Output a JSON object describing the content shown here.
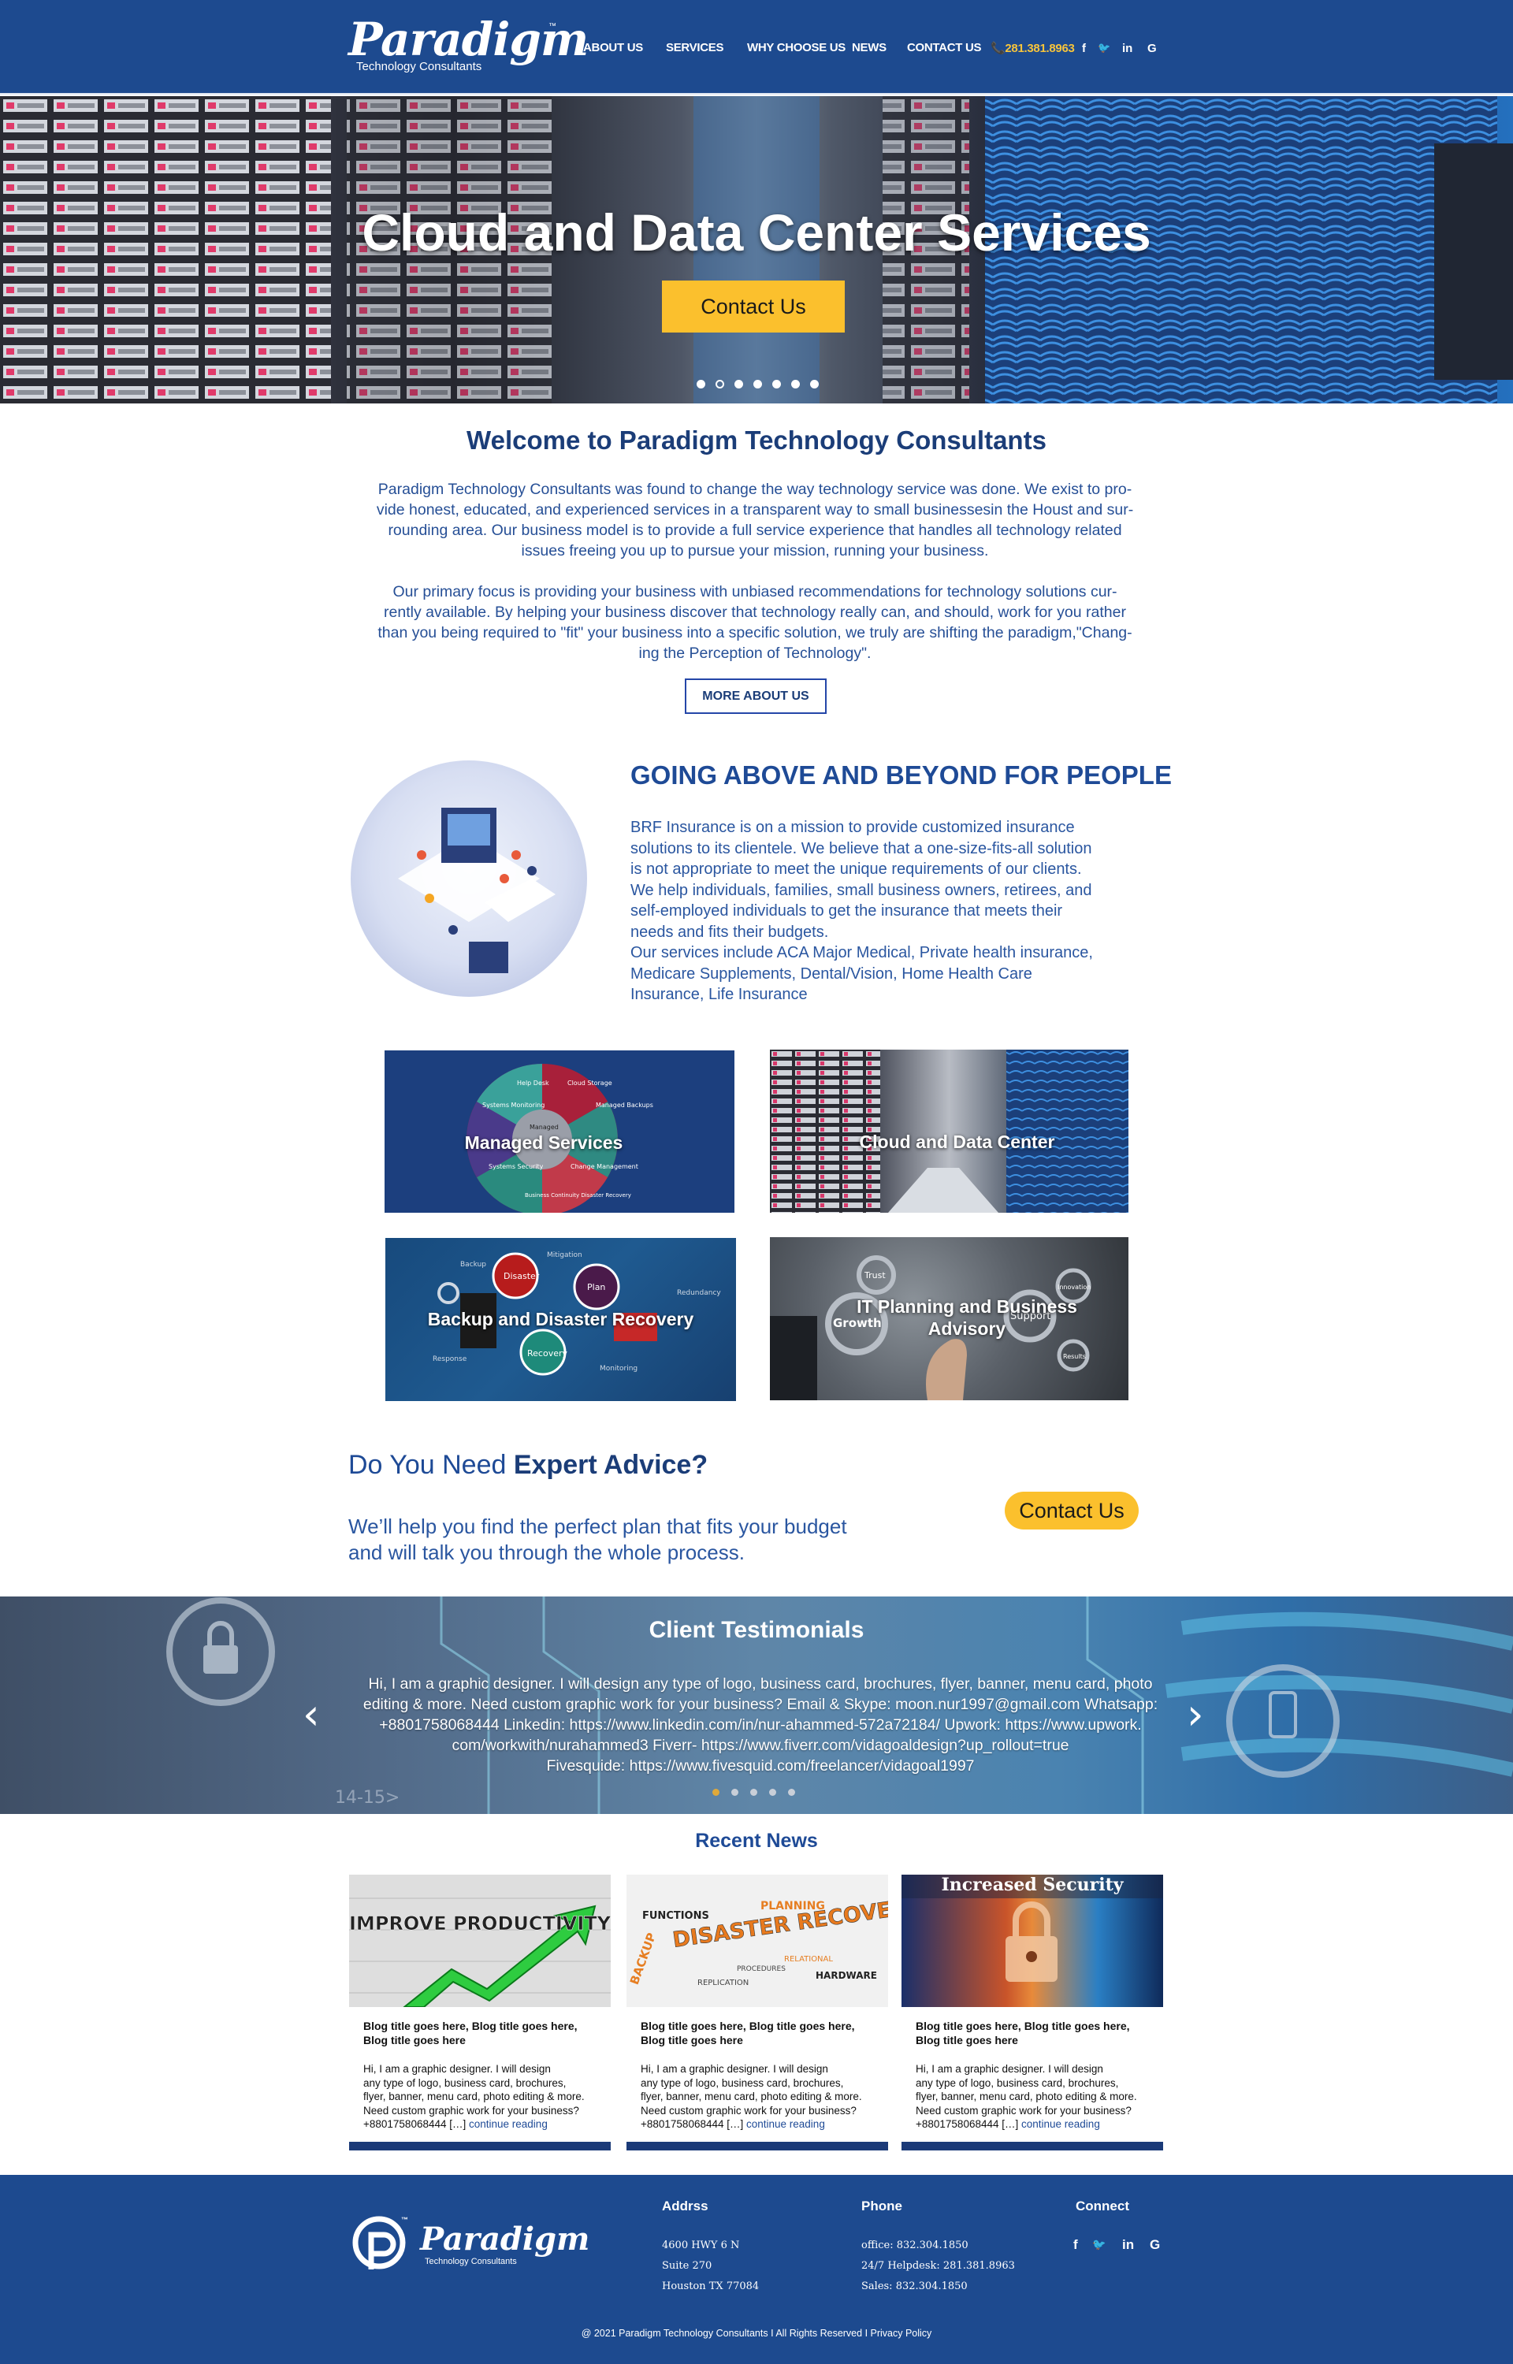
{
  "header": {
    "logo_text": "Paradigm",
    "logo_tm": "™",
    "logo_sub": "Technology Consultants",
    "nav": [
      "ABOUT US",
      "SERVICES",
      "WHY CHOOSE US",
      "NEWS",
      "CONTACT US"
    ],
    "phone": "📞281.381.8963",
    "social_icons": [
      "facebook-icon",
      "twitter-icon",
      "linkedin-icon",
      "google-icon"
    ],
    "social_glyphs": [
      "f",
      "🐦",
      "in",
      "G"
    ]
  },
  "hero": {
    "title": "Cloud and Data Center Services",
    "button": "Contact Us",
    "slides": 7,
    "active_slide": 2
  },
  "welcome": {
    "title": "Welcome to Paradigm Technology Consultants",
    "p1_lines": [
      "Paradigm Technology Consultants was found to change the way technology service was done. We exist to pro-",
      "vide honest, educated, and experienced services in a transparent way to small businessesin the Houst and sur-",
      "rounding area. Our business model is to provide a full service experience that handles all technology related",
      "issues freeing you up to pursue your mission, running your business."
    ],
    "p2_lines": [
      "Our primary focus is providing your business with unbiased recommendations for technology solutions cur-",
      "rently available. By helping your business discover that technology really can, and should, work for you rather",
      "than you being required to \"fit\" your business into a specific solution, we truly are shifting the paradigm,\"Chang-",
      "ing the Perception of Technology\"."
    ],
    "button": "MORE ABOUT US"
  },
  "above": {
    "title": "GOING ABOVE AND BEYOND FOR PEOPLE",
    "lines": [
      "BRF Insurance is on a mission to provide customized insurance",
      "solutions to its clientele. We believe that a one-size-fits-all solution",
      "is not appropriate to meet the unique requirements of our clients.",
      "We help individuals, families, small business owners, retirees, and",
      "self-employed individuals to get the insurance that meets their",
      "needs and fits their budgets.",
      "Our services include ACA Major Medical, Private health insurance,",
      "Medicare Supplements, Dental/Vision, Home Health Care",
      "Insurance, Life Insurance"
    ],
    "image_icon": "technology-illustration-icon"
  },
  "services": [
    {
      "label": "Managed Services"
    },
    {
      "label": "Cloud and Data Center"
    },
    {
      "label": "Backup and Disaster Recovery"
    },
    {
      "label": "IT Planning and Business Advisory"
    }
  ],
  "service_wheel_labels": [
    "Help Desk",
    "Cloud Storage",
    "Managed Backups",
    "Managed",
    "Systems Monitoring",
    "Systems Security",
    "Business Continuity Disaster Recovery",
    "Change Management"
  ],
  "backup_labels": [
    "Disaster",
    "Plan",
    "Recovery",
    "Backup",
    "Mitigation",
    "Redundancy",
    "Response",
    "Monitoring"
  ],
  "advisory_labels": [
    "Trust",
    "Growth",
    "Support",
    "Innovation",
    "Results"
  ],
  "expert": {
    "title_plain": "Do You Need ",
    "title_bold": "Expert Advice?",
    "lines": [
      "We’ll help you find the perfect plan that fits your budget",
      "and will talk you through the whole process."
    ],
    "button": "Contact Us"
  },
  "testimonials": {
    "title": "Client Testimonials",
    "lines": [
      "Hi, I am a graphic designer. I will design any type of logo, business card, brochures, flyer, banner, menu card, photo",
      "editing & more. Need custom graphic work for your business? Email & Skype: moon.nur1997@gmail.com Whatsapp:",
      "+8801758068444 Linkedin: https://www.linkedin.com/in/nur-ahammed-572a72184/ Upwork: https://www.upwork.",
      "com/workwith/nurahammed3 Fiverr- https://www.fiverr.com/vidagoaldesign?up_rollout=true",
      "Fivesquide: https://www.fivesquid.com/freelancer/vidagoal1997"
    ],
    "prev_icon": "chevron-left-icon",
    "next_icon": "chevron-right-icon",
    "prev": "‹",
    "next": "›",
    "slides": 5,
    "active_slide": 0,
    "bg_text": "14-15>"
  },
  "news": {
    "title": "Recent News",
    "cards": [
      {
        "image_text": "IMPROVE PRODUCTIVITY",
        "headline_lines": [
          "Blog title goes here, Blog title goes here,",
          "Blog title goes here"
        ],
        "body_lines": [
          "Hi, I am a graphic designer. I will design",
          "any type of logo, business card, brochures,",
          "flyer, banner, menu card, photo editing & more.",
          "Need custom graphic work for your business?"
        ],
        "last_line": "+8801758068444 […] ",
        "more": "continue reading"
      },
      {
        "image_text": "DISASTER RECOVERY",
        "image_words": [
          "FUNCTIONS",
          "PLANNING",
          "BACKUP",
          "HARDWARE",
          "REPLICATION",
          "RELATIONAL",
          "PROCEDURES"
        ],
        "headline_lines": [
          "Blog title goes here, Blog title goes here,",
          "Blog title goes here"
        ],
        "body_lines": [
          "Hi, I am a graphic designer. I will design",
          "any type of logo, business card, brochures,",
          "flyer, banner, menu card, photo editing & more.",
          "Need custom graphic work for your business?"
        ],
        "last_line": "+8801758068444 […] ",
        "more": "continue reading"
      },
      {
        "image_text": "Increased Security",
        "headline_lines": [
          "Blog title goes here, Blog title goes here,",
          "Blog title goes here"
        ],
        "body_lines": [
          "Hi, I am a graphic designer. I will design",
          "any type of logo, business card, brochures,",
          "flyer, banner, menu card, photo editing & more.",
          "Need custom graphic work for your business?"
        ],
        "last_line": "+8801758068444 […] ",
        "more": "continue reading"
      }
    ]
  },
  "footer": {
    "logo_text": "Paradigm",
    "logo_tm": "™",
    "logo_sub": "Technology Consultants",
    "address_title": "Addrss",
    "address_lines": [
      "4600 HWY 6 N",
      "Suite 270",
      "Houston TX 77084"
    ],
    "phone_title": "Phone",
    "phone_lines": [
      "office: 832.304.1850",
      "24/7 Helpdesk: 281.381.8963",
      "Sales: 832.304.1850"
    ],
    "connect_title": "Connect",
    "copyright": "@ 2021 Paradigm Technology Consultants I All Rights Reserved I Privacy Policy"
  },
  "colors": {
    "brand_blue": "#1d4a8f",
    "accent_yellow": "#fbc02d",
    "heading_blue": "#1b3d78",
    "text_blue": "#2a56a0"
  }
}
